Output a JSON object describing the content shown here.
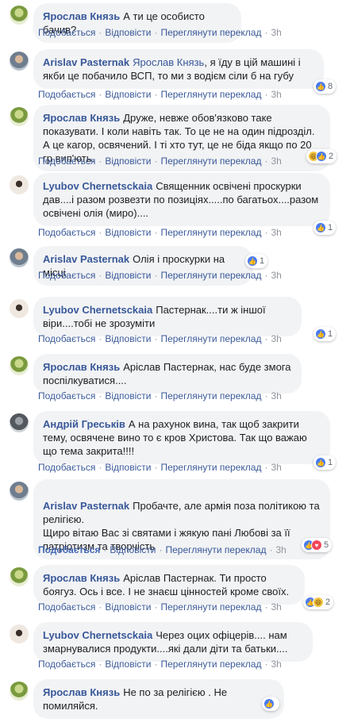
{
  "action_labels": {
    "like": "Подобається",
    "reply": "Відповісти",
    "translate": "Переглянути переклад",
    "sep": "·"
  },
  "comments": [
    {
      "author": "Ярослав Князь",
      "text": "А ти це особисто бачив?",
      "time": "3h",
      "liked": false,
      "reactions": null
    },
    {
      "author": "Arislav Pasternak",
      "mention": "Ярослав Князь",
      "text": ", я їду в цій машині і якби це побачило ВСП, то ми з водієм сіли б на губу",
      "time": "3h",
      "liked": false,
      "reactions": {
        "icons": [
          "like-icon"
        ],
        "count": "8"
      }
    },
    {
      "author": "Ярослав Князь",
      "text": "Друже, невже обов'язково таке показувати. І коли навіть так. То це не на один підрозділ. А це кагор, освячений. І ті хто тут, це не біда якщо по 20 гр вип'ють.",
      "time": "3h",
      "liked": false,
      "reactions": {
        "icons": [
          "haha-icon",
          "like-icon"
        ],
        "count": "2"
      }
    },
    {
      "author": "Lyubov Chernetsckaia",
      "text": "Священник освічені проскурки дав....і разом розвезти по позиціях.....по багатьох....разом освічені олія (миро)....",
      "time": "3h",
      "liked": false,
      "reactions": {
        "icons": [
          "like-icon"
        ],
        "count": "1"
      }
    },
    {
      "author": "Arislav Pasternak",
      "text": "Олія і проскурки на місці",
      "time": "3h",
      "liked": false,
      "reactions": {
        "icons": [
          "like-icon"
        ],
        "count": "1"
      }
    },
    {
      "author": "Lyubov Chernetsckaia",
      "text": "Пастернак....ти ж іншої віри....тобі не зрозуміти",
      "time": "3h",
      "liked": false,
      "reactions": {
        "icons": [
          "like-icon"
        ],
        "count": "1"
      }
    },
    {
      "author": "Ярослав Князь",
      "text": "Аріслав Пастернак, нас буде змога поспілкуватися....",
      "time": "3h",
      "liked": false,
      "reactions": null
    },
    {
      "author": "Андрій Греськів",
      "text": "А на рахунок вина, так щоб закрити тему, освячене вино то є кров Христова. Так що важаю що тема закрита!!!!",
      "time": "3h",
      "liked": false,
      "reactions": {
        "icons": [
          "like-icon"
        ],
        "count": "1"
      }
    },
    {
      "author": "Arislav Pasternak",
      "text": "Пробачте, але армія поза політикою та релігією.\nЩиро вітаю Вас зі святами і жякую пані Любові за її патріотизм та творчість",
      "time": "3h",
      "liked": true,
      "reactions": {
        "icons": [
          "like-icon",
          "love-icon"
        ],
        "count": "5"
      }
    },
    {
      "author": "Ярослав Князь",
      "text": "Аріслав Пастернак. Ти просто боягуз. Ось і все. І не знаєш цінностей кроме своїх.",
      "time": "3h",
      "liked": false,
      "reactions": {
        "icons": [
          "like-icon",
          "haha-icon"
        ],
        "count": "2"
      }
    },
    {
      "author": "Lyubov Chernetsckaia",
      "text": "Через оцих офіцерів.... нам змарнувалися продукти....які дали діти та батьки....",
      "time": "3h",
      "liked": false,
      "reactions": null
    },
    {
      "author": "Ярослав Князь",
      "text": "Не по за релігією . Не помиляйся.",
      "time": "",
      "liked": false,
      "reactions": {
        "icons": [
          "like-icon"
        ],
        "count": ""
      }
    }
  ]
}
